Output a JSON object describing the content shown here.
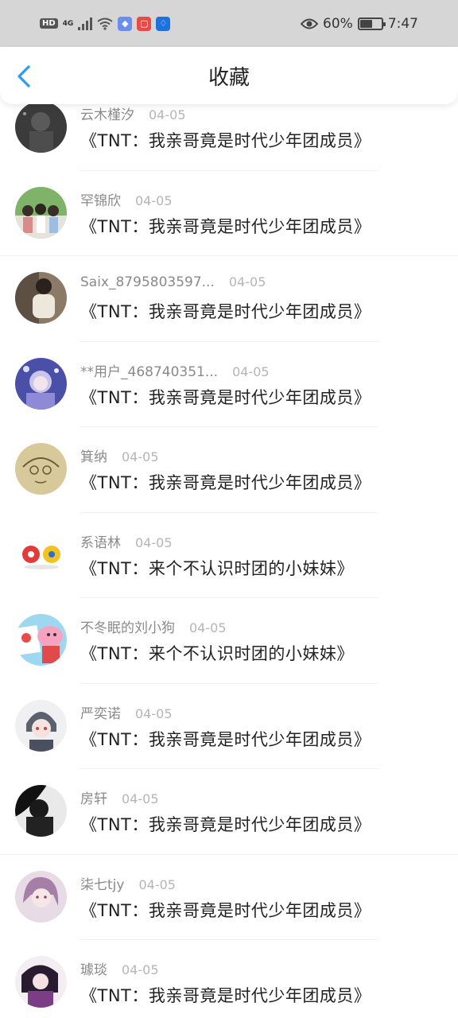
{
  "status_bar": {
    "network_hd": "HD",
    "network_gen": "4G",
    "battery_percent": "60%",
    "battery_level": 0.6,
    "time": "7:47"
  },
  "header": {
    "title": "收藏"
  },
  "items": [
    {
      "username": "云木槿汐",
      "date": "04-05",
      "title": "《TNT：我亲哥竟是时代少年团成员》"
    },
    {
      "username": "罕锦欣",
      "date": "04-05",
      "title": "《TNT：我亲哥竟是时代少年团成员》"
    },
    {
      "username": "Saix_8795803597...",
      "date": "04-05",
      "title": "《TNT：我亲哥竟是时代少年团成员》"
    },
    {
      "username": "**用户_468740351...",
      "date": "04-05",
      "title": "《TNT：我亲哥竟是时代少年团成员》"
    },
    {
      "username": "箕纳",
      "date": "04-05",
      "title": "《TNT：我亲哥竟是时代少年团成员》"
    },
    {
      "username": "系语林",
      "date": "04-05",
      "title": "《TNT：来个不认识时团的小妹妹》"
    },
    {
      "username": "不冬眠的刘小狗",
      "date": "04-05",
      "title": "《TNT：来个不认识时团的小妹妹》"
    },
    {
      "username": "严奕诺",
      "date": "04-05",
      "title": "《TNT：我亲哥竟是时代少年团成员》"
    },
    {
      "username": "房轩",
      "date": "04-05",
      "title": "《TNT：我亲哥竟是时代少年团成员》"
    },
    {
      "username": "柒七tjy",
      "date": "04-05",
      "title": "《TNT：我亲哥竟是时代少年团成员》"
    },
    {
      "username": "璩琰",
      "date": "04-05",
      "title": "《TNT：我亲哥竟是时代少年团成员》"
    }
  ],
  "colors": {
    "accent": "#2a9df4",
    "status_bar_bg": "#d6d6d6",
    "username": "#8a8a8a",
    "date": "#b5b5b5",
    "title": "#222222"
  }
}
